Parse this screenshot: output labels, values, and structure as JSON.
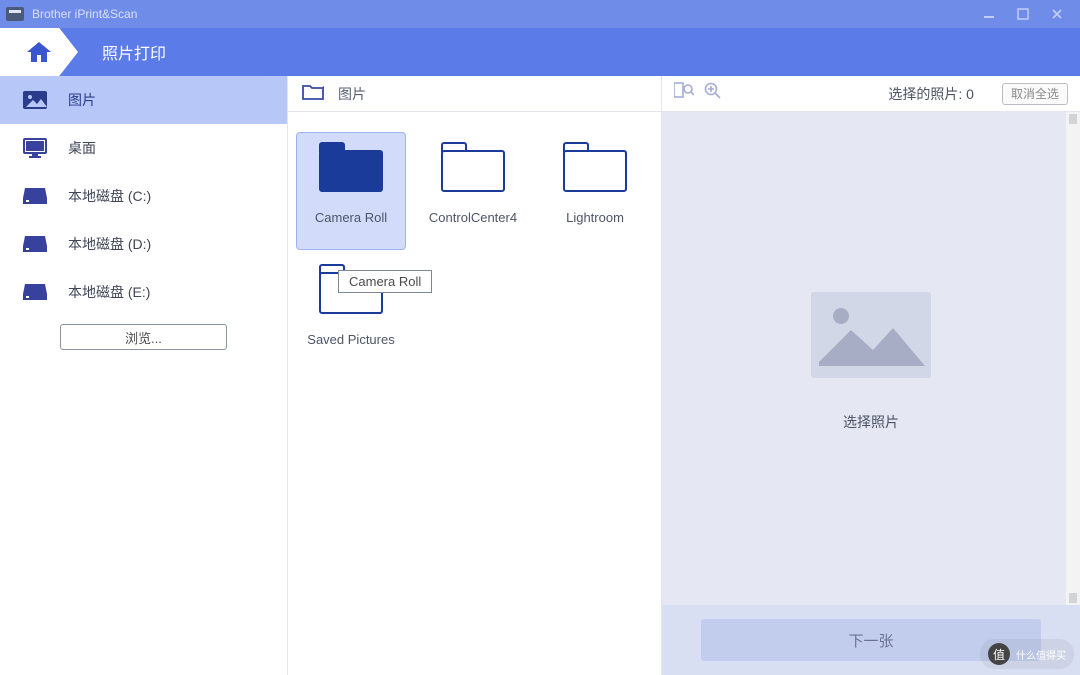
{
  "app": {
    "title": "Brother iPrint&Scan"
  },
  "header": {
    "title": "照片打印"
  },
  "sidebar": {
    "items": [
      {
        "label": "图片",
        "icon": "image",
        "active": true
      },
      {
        "label": "桌面",
        "icon": "monitor",
        "active": false
      },
      {
        "label": "本地磁盘 (C:)",
        "icon": "disk",
        "active": false
      },
      {
        "label": "本地磁盘 (D:)",
        "icon": "disk",
        "active": false
      },
      {
        "label": "本地磁盘 (E:)",
        "icon": "disk",
        "active": false
      }
    ],
    "browse_label": "浏览..."
  },
  "center": {
    "breadcrumb_label": "图片",
    "folders": [
      {
        "label": "Camera Roll",
        "selected": true
      },
      {
        "label": "ControlCenter4",
        "selected": false
      },
      {
        "label": "Lightroom",
        "selected": false
      },
      {
        "label": "Saved Pictures",
        "selected": false
      }
    ],
    "tooltip_text": "Camera Roll"
  },
  "right": {
    "selected_count_label": "选择的照片: 0",
    "deselect_label": "取消全选",
    "placeholder_text": "选择照片",
    "next_label": "下一张"
  },
  "watermark": {
    "brand": "什么值得买",
    "char": "值"
  }
}
